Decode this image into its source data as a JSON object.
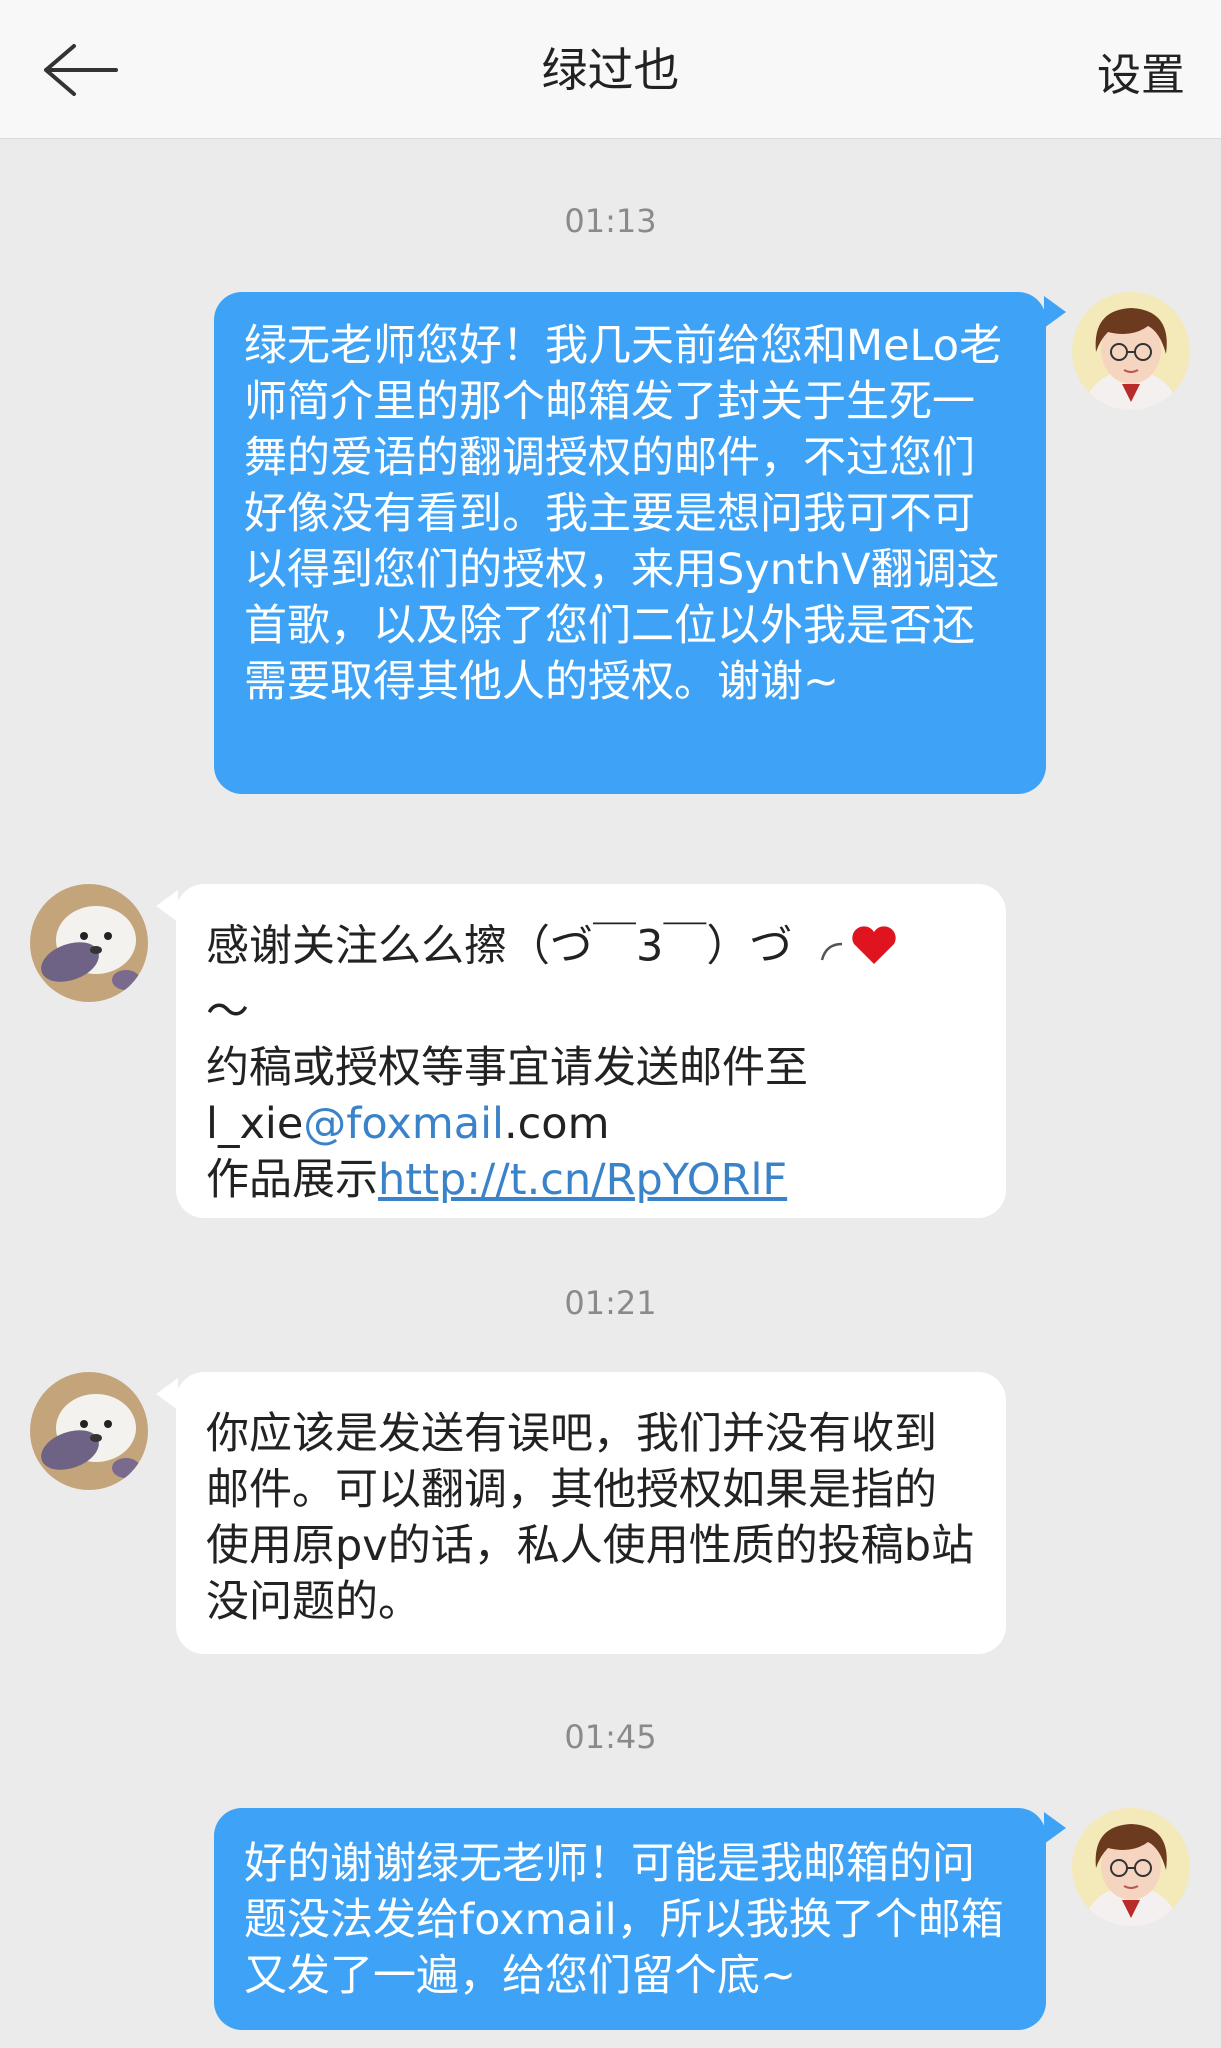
{
  "header": {
    "title": "绿过也",
    "settings_label": "设置"
  },
  "messages": [
    {
      "timestamp": "01:13"
    },
    {
      "text": "绿无老师您好！我几天前给您和MeLo老师简介里的那个邮箱发了封关于生死一舞的爱语的翻调授权的邮件，不过您们好像没有看到。我主要是想问我可不可以得到您们的授权，来用SynthV翻调这首歌，以及除了您们二位以外我是否还需要取得其他人的授权。谢谢~"
    },
    {
      "line1": "感谢关注么么擦（づ￣3￣）づ",
      "line2": "～",
      "line3": "约稿或授权等事宜请发送邮件至",
      "email_user": "l_xie",
      "email_domain": "@foxmail",
      "email_tld": ".com",
      "showcase_label": "作品展示",
      "showcase_url": "http://t.cn/RpYORlF"
    },
    {
      "timestamp": "01:21"
    },
    {
      "text": "你应该是发送有误吧，我们并没有收到邮件。可以翻调，其他授权如果是指的使用原pv的话，私人使用性质的投稿b站没问题的。"
    },
    {
      "timestamp": "01:45"
    },
    {
      "text": "好的谢谢绿无老师！可能是我邮箱的问题没法发给foxmail，所以我换了个邮箱又发了一遍，给您们留个底~"
    }
  ],
  "colors": {
    "outgoing_bubble": "#3ea3f7",
    "incoming_bubble": "#ffffff",
    "background": "#ebebeb",
    "link": "#3a83c9",
    "heart": "#e0141e"
  }
}
